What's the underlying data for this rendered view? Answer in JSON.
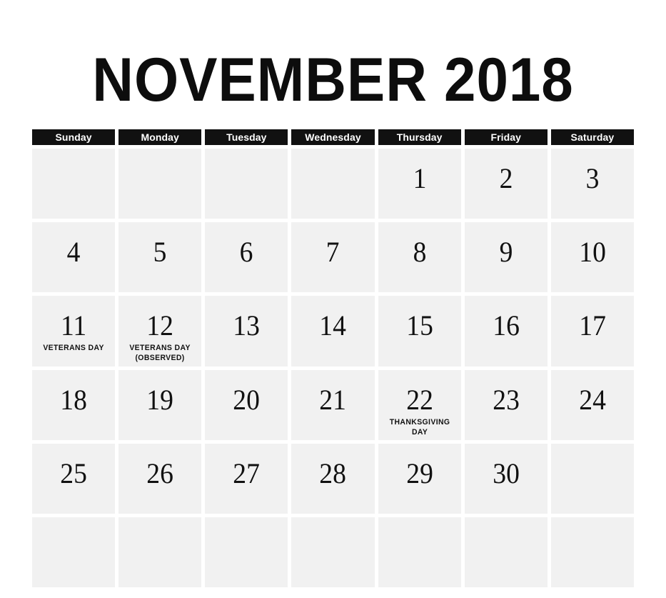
{
  "title": "NOVEMBER 2018",
  "month_name": "November",
  "year": "2018",
  "colors": {
    "page_background": "#ffffff",
    "header_background": "#111111",
    "header_text": "#ffffff",
    "cell_background": "#f1f1f1",
    "cell_gap": "#ffffff",
    "text": "#111111"
  },
  "weekdays": [
    {
      "label": "Sunday"
    },
    {
      "label": "Monday"
    },
    {
      "label": "Tuesday"
    },
    {
      "label": "Wednesday"
    },
    {
      "label": "Thursday"
    },
    {
      "label": "Friday"
    },
    {
      "label": "Saturday"
    }
  ],
  "weeks": [
    {
      "days": [
        {
          "number": "",
          "event": ""
        },
        {
          "number": "",
          "event": ""
        },
        {
          "number": "",
          "event": ""
        },
        {
          "number": "",
          "event": ""
        },
        {
          "number": "1",
          "event": ""
        },
        {
          "number": "2",
          "event": ""
        },
        {
          "number": "3",
          "event": ""
        }
      ]
    },
    {
      "days": [
        {
          "number": "4",
          "event": ""
        },
        {
          "number": "5",
          "event": ""
        },
        {
          "number": "6",
          "event": ""
        },
        {
          "number": "7",
          "event": ""
        },
        {
          "number": "8",
          "event": ""
        },
        {
          "number": "9",
          "event": ""
        },
        {
          "number": "10",
          "event": ""
        }
      ]
    },
    {
      "days": [
        {
          "number": "11",
          "event": "VETERANS DAY"
        },
        {
          "number": "12",
          "event": "VETERANS DAY (OBSERVED)"
        },
        {
          "number": "13",
          "event": ""
        },
        {
          "number": "14",
          "event": ""
        },
        {
          "number": "15",
          "event": ""
        },
        {
          "number": "16",
          "event": ""
        },
        {
          "number": "17",
          "event": ""
        }
      ]
    },
    {
      "days": [
        {
          "number": "18",
          "event": ""
        },
        {
          "number": "19",
          "event": ""
        },
        {
          "number": "20",
          "event": ""
        },
        {
          "number": "21",
          "event": ""
        },
        {
          "number": "22",
          "event": "THANKSGIVING DAY"
        },
        {
          "number": "23",
          "event": ""
        },
        {
          "number": "24",
          "event": ""
        }
      ]
    },
    {
      "days": [
        {
          "number": "25",
          "event": ""
        },
        {
          "number": "26",
          "event": ""
        },
        {
          "number": "27",
          "event": ""
        },
        {
          "number": "28",
          "event": ""
        },
        {
          "number": "29",
          "event": ""
        },
        {
          "number": "30",
          "event": ""
        },
        {
          "number": "",
          "event": ""
        }
      ]
    },
    {
      "days": [
        {
          "number": "",
          "event": ""
        },
        {
          "number": "",
          "event": ""
        },
        {
          "number": "",
          "event": ""
        },
        {
          "number": "",
          "event": ""
        },
        {
          "number": "",
          "event": ""
        },
        {
          "number": "",
          "event": ""
        },
        {
          "number": "",
          "event": ""
        }
      ]
    }
  ]
}
